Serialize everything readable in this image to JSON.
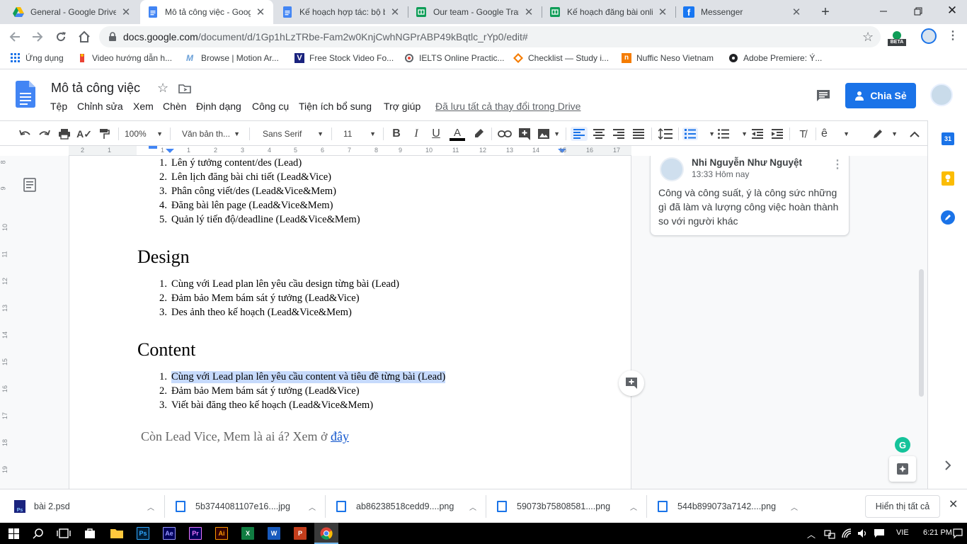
{
  "browser": {
    "tabs": [
      {
        "title": "General - Google Drive",
        "icon": "google-drive-icon"
      },
      {
        "title": "Mô tả công việc - Goog",
        "icon": "google-docs-icon",
        "active": true
      },
      {
        "title": "Kế hoạch hợp tác: bộ b",
        "icon": "google-docs-icon"
      },
      {
        "title": "Our team - Google Tran",
        "icon": "google-sheets-icon"
      },
      {
        "title": "Kế hoạch đăng bài onli",
        "icon": "google-sheets-icon"
      },
      {
        "title": "Messenger",
        "icon": "facebook-icon"
      }
    ],
    "url_host": "docs.google.com",
    "url_path": "/document/d/1Gp1hLzTRbe-Fam2w0KnjCwhNGPrABP49kBqtlc_rYp0/edit#",
    "beta_label": "BETA",
    "bookmarks": [
      {
        "label": "Ứng dụng",
        "icon": "apps-grid-icon"
      },
      {
        "label": "Video hướng dẫn h...",
        "icon": "bookmark-icon"
      },
      {
        "label": "Browse | Motion Ar...",
        "icon": "motion-array-icon"
      },
      {
        "label": "Free Stock Video Fo...",
        "icon": "videvo-icon"
      },
      {
        "label": "IELTS Online Practic...",
        "icon": "ielts-icon"
      },
      {
        "label": "Checklist — Study i...",
        "icon": "checklist-icon"
      },
      {
        "label": "Nuffic Neso Vietnam",
        "icon": "nuffic-icon"
      },
      {
        "label": "Adobe Premiere: Ý...",
        "icon": "adobe-premiere-icon"
      }
    ]
  },
  "docs": {
    "title": "Mô tả công việc",
    "menus": [
      "Tệp",
      "Chỉnh sửa",
      "Xem",
      "Chèn",
      "Định dạng",
      "Công cụ",
      "Tiện ích bổ sung",
      "Trợ giúp"
    ],
    "saved_status": "Đã lưu tất cả thay đổi trong Drive",
    "share_label": "Chia Sẻ",
    "toolbar": {
      "zoom": "100%",
      "style": "Văn bản th...",
      "font": "Sans Serif",
      "size": "11"
    },
    "ruler_numbers": [
      "2",
      "1",
      "1",
      "1",
      "2",
      "3",
      "4",
      "5",
      "6",
      "7",
      "8",
      "9",
      "10",
      "11",
      "12",
      "13",
      "14",
      "15",
      "16",
      "17",
      "18"
    ],
    "left_ruler_numbers": [
      "8",
      "9",
      "10",
      "11",
      "12",
      "13",
      "14",
      "15",
      "16",
      "17",
      "18",
      "19"
    ]
  },
  "document": {
    "list1": [
      {
        "n": "1.",
        "text": "Lên ý tưởng content/des (Lead)"
      },
      {
        "n": "2.",
        "text": "Lên lịch đăng bài chi tiết (Lead&Vice)"
      },
      {
        "n": "3.",
        "text": "Phân công viết/des (Lead&Vice&Mem)"
      },
      {
        "n": "4.",
        "text": "Đăng bài lên page (Lead&Vice&Mem)"
      },
      {
        "n": "5.",
        "text": "Quản lý tiến độ/deadline (Lead&Vice&Mem)"
      }
    ],
    "heading_design": "Design",
    "list2": [
      {
        "n": "1.",
        "text": "Cùng với Lead plan lên yêu cầu design từng bài (Lead)"
      },
      {
        "n": "2.",
        "text": "Đảm bảo Mem bám sát ý tưởng (Lead&Vice)"
      },
      {
        "n": "3.",
        "text": "Des ảnh theo kế hoạch (Lead&Vice&Mem)"
      }
    ],
    "heading_content": "Content",
    "list3": [
      {
        "n": "1.",
        "text": "Cùng với Lead plan lên yêu cầu content và tiêu đề từng bài (Lead)",
        "selected": true
      },
      {
        "n": "2.",
        "text": "Đảm bảo Mem bám sát ý tưởng (Lead&Vice)"
      },
      {
        "n": "3.",
        "text": "Viết bài đăng theo kế hoạch (Lead&Vice&Mem)"
      }
    ],
    "footer_text": "Còn Lead Vice, Mem là ai á? Xem ở ",
    "footer_link": "đây"
  },
  "comment": {
    "author": "Nhi Nguyễn Như Nguyệt",
    "time": "13:33 Hôm nay",
    "text": "Công và công suất, ý là công sức những gì đã làm và lượng công việc hoàn thành so với người khác"
  },
  "downloads": {
    "items": [
      "bài 2.psd",
      "5b3744081107e16....jpg",
      "ab86238518cedd9....png",
      "59073b75808581....png",
      "544b899073a7142....png"
    ],
    "show_all": "Hiển thị tất cả"
  },
  "taskbar": {
    "apps": [
      "Ps",
      "Ae",
      "Pr",
      "Ai",
      "X",
      "W",
      "P"
    ],
    "language": "VIE",
    "time": "6:21 PM"
  },
  "colors": {
    "accent": "#1a73e8",
    "selection": "#c6dafc",
    "docs_blue": "#4285f4",
    "sheets_green": "#0f9d58"
  }
}
